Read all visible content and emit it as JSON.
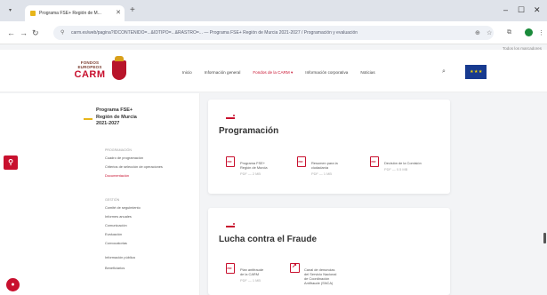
{
  "browser": {
    "tab_title": "Programa FSE+ Región de M...",
    "address": "carm.es/web/pagina?IDCONTENIDO=...&IDTIPO=...&RASTRO=... — Programa FSE+ Región de Murcia 2021-2027 / Programación y evaluación",
    "bookmarks_label": "Todos los marcadores",
    "window_controls": [
      "–",
      "☐",
      "✕"
    ]
  },
  "header": {
    "logo_line1": "FONDOS",
    "logo_line2": "EUROPEOS",
    "logo_line3": "CARM",
    "nav": [
      "Inicio",
      "Información general",
      "Fondos de la CARM ▾",
      "Información corporativa",
      "Noticias"
    ],
    "nav_active_index": 2,
    "eu_flag_text": "★ ★ ★"
  },
  "sidebar": {
    "program_title": "Programa FSE+\nRegión de Murcia\n2021-2027",
    "groups": [
      {
        "heading": "Programación",
        "items": [
          "Cuadro de programación",
          "Criterios de selección de operaciones",
          "Documentación"
        ],
        "active_index": 2
      },
      {
        "heading": "Gestión",
        "items": [
          "Comité de seguimiento",
          "Informes anuales",
          "Comunicación",
          "Evaluación",
          "Convocatorias",
          "Información pública",
          "Beneficiarios"
        ]
      }
    ]
  },
  "cards": [
    {
      "title": "Programación",
      "documents": [
        {
          "label": "Programa FSE+\nRegión de Murcia",
          "size": "PDF — 2 MB"
        },
        {
          "label": "Resumen para la ciudadanía",
          "size": "PDF — 1 MB"
        },
        {
          "label": "Decisión de la Comisión",
          "size": "PDF — 0.5 MB"
        }
      ]
    },
    {
      "title": "Lucha contra el Fraude",
      "documents": [
        {
          "label": "Plan antifraude\nde la CARM",
          "size": "PDF — 1 MB",
          "icon": "pdf"
        },
        {
          "label": "Canal de denuncias\ndel Servicio Nacional\nde Coordinación\nAntifraude (SNCA)",
          "size": "",
          "icon": "link"
        }
      ]
    }
  ],
  "colors": {
    "accent": "#c8102e",
    "gold": "#e7b51a",
    "eu_blue": "#173a8f"
  }
}
